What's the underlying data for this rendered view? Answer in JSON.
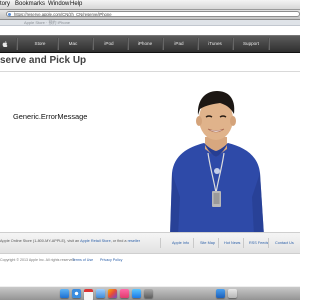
{
  "menubar": {
    "items": [
      "tory",
      "Bookmarks",
      "Window",
      "Help"
    ]
  },
  "browser": {
    "url": "https://reserve.apple.com/CN/zh_CN/reserve/iPhone"
  },
  "subbar": {
    "text": "Apple Store · 预约 iPhone"
  },
  "nav": {
    "items": [
      "Store",
      "Mac",
      "iPod",
      "iPhone",
      "iPad",
      "iTunes",
      "Support"
    ]
  },
  "heading": "serve and Pick Up",
  "error_message": "Generic.ErrorMessage",
  "footer": {
    "left_text": "Apple Online Store (1-800-MY-APPLE), visit an",
    "left_link1": "Apple Retail Store",
    "left_mid": ", or find a",
    "left_link2": "reseller",
    "links": [
      "Apple Info",
      "Site Map",
      "Hot News",
      "RSS Feeds",
      "Contact Us"
    ]
  },
  "copyright": {
    "text": "Copyright © 2013 Apple Inc. All rights reserved.",
    "terms": "Terms of Use",
    "privacy": "Privacy Policy"
  },
  "colors": {
    "nav_bg": "#3f3f3f",
    "link": "#2b5fa8",
    "shirt": "#2e4aa8"
  },
  "dock": {
    "icons": [
      "finder-icon",
      "safari-icon",
      "calendar-icon",
      "mail-icon",
      "photos-icon",
      "music-icon",
      "app-store-icon",
      "preferences-icon",
      "downloads-icon",
      "trash-icon"
    ]
  }
}
